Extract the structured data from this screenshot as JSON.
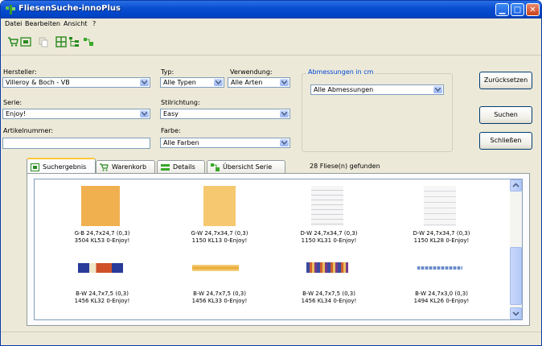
{
  "window": {
    "title": "FliesenSuche-innoPlus",
    "accent": "#0a4fd0"
  },
  "menu": [
    "Datei",
    "Bearbeiten",
    "Ansicht",
    "?"
  ],
  "filters": {
    "hersteller": {
      "label": "Hersteller:",
      "value": "Villeroy & Boch - VB"
    },
    "typ": {
      "label": "Typ:",
      "value": "Alle Typen"
    },
    "verwendung": {
      "label": "Verwendung:",
      "value": "Alle Arten"
    },
    "serie": {
      "label": "Serie:",
      "value": "Enjoy!"
    },
    "stilrichtung": {
      "label": "Stilrichtung:",
      "value": "Easy"
    },
    "artikelnummer": {
      "label": "Artikelnummer:",
      "value": ""
    },
    "farbe": {
      "label": "Farbe:",
      "value": "Alle Farben"
    },
    "abmessungen": {
      "group_label": "Abmessungen in cm",
      "value": "Alle Abmessungen"
    }
  },
  "buttons": {
    "reset": "Zurücksetzen",
    "search": "Suchen",
    "close": "Schließen"
  },
  "tabs": [
    {
      "label": "Suchergebnis",
      "icon": "results-icon",
      "active": true
    },
    {
      "label": "Warenkorb",
      "icon": "cart-icon",
      "active": false
    },
    {
      "label": "Details",
      "icon": "details-icon",
      "active": false
    },
    {
      "label": "Übersicht Serie",
      "icon": "series-overview-icon",
      "active": false
    }
  ],
  "found_text": "28 Fliese(n) gefunden",
  "results": [
    {
      "line1": "G-B 24,7x24,7 (0,3)",
      "line2": "3504 KL53 0-Enjoy!",
      "swatch": "orange-plain"
    },
    {
      "line1": "G-W 24,7x34,7 (0,3)",
      "line2": "1150 KL13 0-Enjoy!",
      "swatch": "yellow-plain"
    },
    {
      "line1": "D-W 24,7x34,7 (0,3)",
      "line2": "1150 KL31 0-Enjoy!",
      "swatch": "white-lines"
    },
    {
      "line1": "D-W 24,7x34,7 (0,3)",
      "line2": "1150 KL28 0-Enjoy!",
      "swatch": "white-lines"
    },
    {
      "line1": "B-W 24,7x7,5 (0,3)",
      "line2": "1456 KL32 0-Enjoy!",
      "swatch": "blue-red-border"
    },
    {
      "line1": "B-W 24,7x7,5 (0,3)",
      "line2": "1456 KL33 0-Enjoy!",
      "swatch": "yellow-border"
    },
    {
      "line1": "B-W 24,7x7,5 (0,3)",
      "line2": "1456 KL34 0-Enjoy!",
      "swatch": "stripe-border"
    },
    {
      "line1": "B-W 24,7x3,0 (0,3)",
      "line2": "1494 KL26 0-Enjoy!",
      "swatch": "thin-blue-border"
    }
  ]
}
